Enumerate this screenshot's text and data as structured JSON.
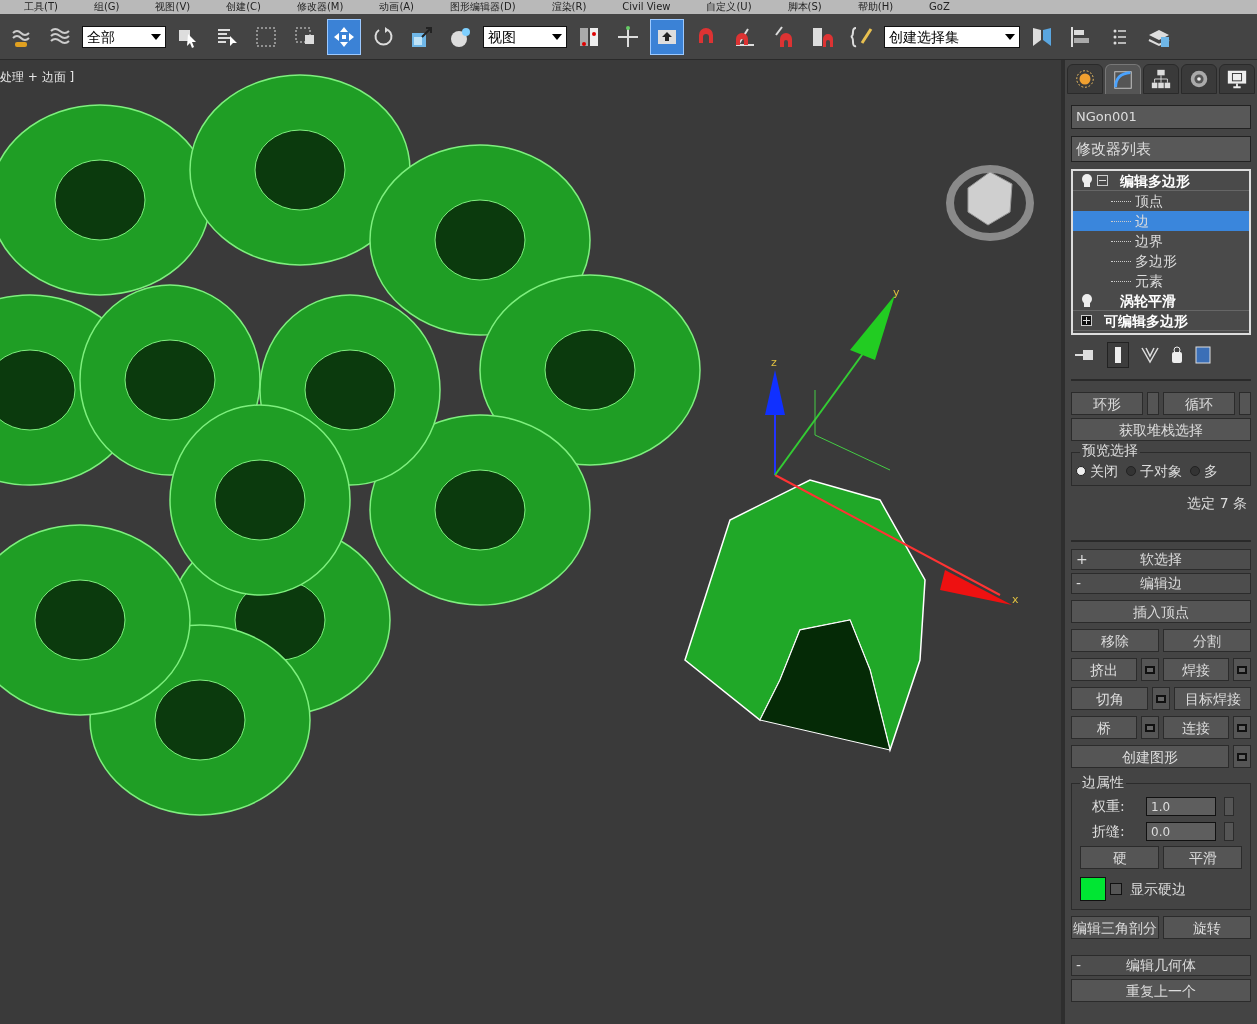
{
  "menu_bar": [
    "工具(T)",
    "组(G)",
    "视图(V)",
    "创建(C)",
    "修改器(M)",
    "动画(A)",
    "图形编辑器(D)",
    "渲染(R)",
    "Civil View",
    "自定义(U)",
    "脚本(S)",
    "帮助(H)",
    "GoZ"
  ],
  "toolbar": [
    {
      "kind": "link",
      "selected": false
    },
    {
      "kind": "bind",
      "selected": false
    },
    {
      "kind": "dropdown",
      "label": "全部",
      "selected": false
    },
    {
      "kind": "select",
      "selected": false
    },
    {
      "kind": "list",
      "selected": false
    },
    {
      "kind": "region",
      "selected": false
    },
    {
      "kind": "crossing",
      "selected": false
    },
    {
      "kind": "move",
      "selected": true
    },
    {
      "kind": "rotate",
      "selected": false
    },
    {
      "kind": "scale",
      "selected": false
    },
    {
      "kind": "sphere",
      "selected": false
    },
    {
      "kind": "dropdown",
      "label": "视图",
      "selected": false
    },
    {
      "kind": "pivot",
      "selected": false
    },
    {
      "kind": "manipulate",
      "selected": false
    },
    {
      "kind": "keyboard",
      "selected": true
    },
    {
      "kind": "snap",
      "selected": false
    },
    {
      "kind": "angle",
      "selected": false
    },
    {
      "kind": "percent",
      "selected": false
    },
    {
      "kind": "spinner",
      "selected": false
    },
    {
      "kind": "braces",
      "selected": false
    },
    {
      "kind": "dropdown",
      "label": "创建选择集",
      "selected": false
    },
    {
      "kind": "mirror",
      "selected": false
    },
    {
      "kind": "align",
      "selected": false
    },
    {
      "kind": "layers",
      "selected": false
    },
    {
      "kind": "explorer",
      "selected": false
    }
  ],
  "viewport": {
    "label": "处理 + 边面 ]",
    "axes": [
      "x",
      "y",
      "z"
    ]
  },
  "command_panel": {
    "tabs": [
      {
        "kind": "create",
        "selected": false
      },
      {
        "kind": "modify",
        "selected": true
      },
      {
        "kind": "hierarchy",
        "selected": false
      },
      {
        "kind": "motion",
        "selected": false
      },
      {
        "kind": "display",
        "selected": false
      }
    ],
    "object_name": "NGon001",
    "modifier_list": "修改器列表",
    "stack": [
      {
        "kind": "modifier",
        "label": "编辑多边形",
        "expanded": true,
        "children": [
          {
            "label": "顶点",
            "selected": false
          },
          {
            "label": "边",
            "selected": true
          },
          {
            "label": "边界",
            "selected": false
          },
          {
            "label": "多边形",
            "selected": false
          },
          {
            "label": "元素",
            "selected": false
          }
        ]
      },
      {
        "kind": "modifier",
        "label": "涡轮平滑"
      },
      {
        "kind": "base",
        "label": "可编辑多边形",
        "expanded": false
      }
    ],
    "selection": {
      "ring": "环形",
      "loop": "循环",
      "stack_button": "获取堆栈选择",
      "preview_title": "预览选择",
      "preview_options": [
        {
          "label": "关闭",
          "selected": true
        },
        {
          "label": "子对象",
          "selected": false
        },
        {
          "label": "多",
          "selected": false
        }
      ],
      "status": "选定 7 条"
    },
    "soft_selection": {
      "sign": "+",
      "title": "软选择"
    },
    "edit_edges": {
      "sign": "-",
      "title": "编辑边",
      "rows": [
        [
          {
            "label": "插入顶点",
            "settings": false
          }
        ],
        [
          {
            "label": "移除",
            "settings": false
          },
          {
            "label": "分割",
            "settings": false
          }
        ],
        [
          {
            "label": "挤出",
            "settings": true
          },
          {
            "label": "焊接",
            "settings": true
          }
        ],
        [
          {
            "label": "切角",
            "settings": true
          },
          {
            "label": "目标焊接",
            "settings": false
          }
        ],
        [
          {
            "label": "桥",
            "settings": true
          },
          {
            "label": "连接",
            "settings": true
          }
        ],
        [
          {
            "label": "创建图形",
            "settings": true
          }
        ]
      ],
      "edge_properties": {
        "title": "边属性",
        "fields": [
          {
            "label": "权重:",
            "value": "1.0"
          },
          {
            "label": "折缝:",
            "value": "0.0"
          }
        ],
        "buttons": [
          "硬",
          "平滑"
        ],
        "color": "#00e633",
        "show_hard_edges": {
          "label": "显示硬边",
          "checked": false
        }
      },
      "bottom_buttons": [
        "编辑三角剖分",
        "旋转"
      ]
    },
    "edit_geometry": {
      "sign": "-",
      "title": "编辑几何体",
      "button": "重复上一个"
    }
  }
}
